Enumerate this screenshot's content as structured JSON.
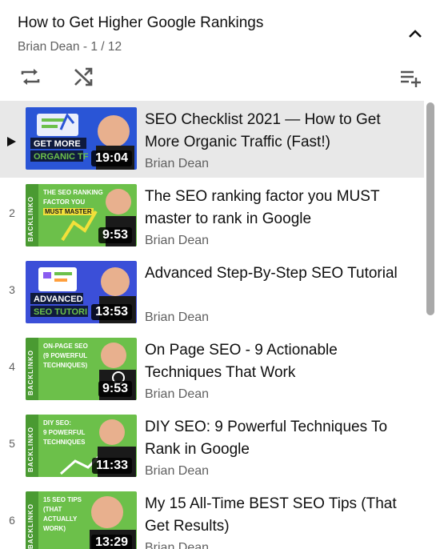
{
  "playlist": {
    "title": "How to Get Higher Google Rankings",
    "subtitle": "Brian Dean - 1 / 12"
  },
  "icons": {
    "collapse": "chevron-up-icon",
    "loop": "loop-icon",
    "shuffle": "shuffle-icon",
    "save": "playlist-add-icon"
  },
  "colors": {
    "active_row": "#e8e8e8",
    "backlinko_green": "#6cc04a",
    "text_secondary": "#606060"
  },
  "videos": [
    {
      "index": "▶",
      "title": "SEO Checklist 2021 — How to Get More Organic Traffic (Fast!)",
      "channel": "Brian Dean",
      "duration": "19:04",
      "thumb_text_1": "GET MORE",
      "thumb_text_2": "ORGANIC TF",
      "active": true
    },
    {
      "index": "2",
      "title": "The SEO ranking factor you MUST master to rank in Google",
      "channel": "Brian Dean",
      "duration": "9:53",
      "thumb_text_1": "THE SEO RANKING",
      "thumb_text_2": "FACTOR YOU",
      "thumb_text_3": "MUST MASTER",
      "brand": "BACKLINKO"
    },
    {
      "index": "3",
      "title": "Advanced Step-By-Step SEO Tutorial",
      "channel": "Brian Dean",
      "duration": "13:53",
      "thumb_text_1": "ADVANCED",
      "thumb_text_2": "SEO TUTORI"
    },
    {
      "index": "4",
      "title": "On Page SEO - 9 Actionable Techniques That Work",
      "channel": "Brian Dean",
      "duration": "9:53",
      "thumb_text_1": "ON-PAGE SEO",
      "thumb_text_2": "(9 POWERFUL",
      "thumb_text_3": "TECHNIQUES)",
      "brand": "BACKLINKO"
    },
    {
      "index": "5",
      "title": "DIY SEO: 9 Powerful Techniques To Rank in Google",
      "channel": "Brian Dean",
      "duration": "11:33",
      "thumb_text_1": "DIY SEO:",
      "thumb_text_2": "9 POWERFUL",
      "thumb_text_3": "TECHNIQUES",
      "brand": "BACKLINKO"
    },
    {
      "index": "6",
      "title": "My 15 All-Time BEST SEO Tips (That Get Results)",
      "channel": "Brian Dean",
      "duration": "13:29",
      "thumb_text_1": "15 SEO TIPS",
      "thumb_text_2": "(THAT",
      "thumb_text_3": "ACTUALLY",
      "thumb_text_4": "WORK)",
      "brand": "BACKLINKO"
    }
  ]
}
